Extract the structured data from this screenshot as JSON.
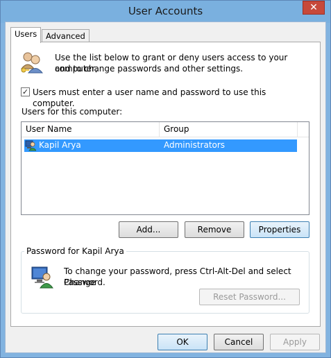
{
  "window": {
    "title": "User Accounts",
    "close_glyph": "✕"
  },
  "tabs": [
    {
      "label": "Users",
      "active": true
    },
    {
      "label": "Advanced",
      "active": false
    }
  ],
  "intro": {
    "icon": "users-icon",
    "line1": "Use the list below to grant or deny users access to your computer,",
    "line2": "and to change passwords and other settings."
  },
  "require_login": {
    "checked": true,
    "check_glyph": "✓",
    "label": "Users must enter a user name and password to use this computer."
  },
  "users_list": {
    "caption": "Users for this computer:",
    "columns": [
      "User Name",
      "Group"
    ],
    "rows": [
      {
        "icon": "user-icon",
        "user_name": "Kapil Arya",
        "group": "Administrators",
        "selected": true
      }
    ]
  },
  "list_buttons": {
    "add": "Add...",
    "remove": "Remove",
    "properties": "Properties"
  },
  "password_group": {
    "legend": "Password for Kapil Arya",
    "icon": "computer-user-icon",
    "line1": "To change your password, press Ctrl-Alt-Del and select Change",
    "line2": "Password.",
    "reset_button": "Reset Password..."
  },
  "dialog_buttons": {
    "ok": "OK",
    "cancel": "Cancel",
    "apply": "Apply"
  },
  "colors": {
    "selection": "#3399ff",
    "title_bar": "#7ab0df",
    "close_button": "#c7493a"
  }
}
